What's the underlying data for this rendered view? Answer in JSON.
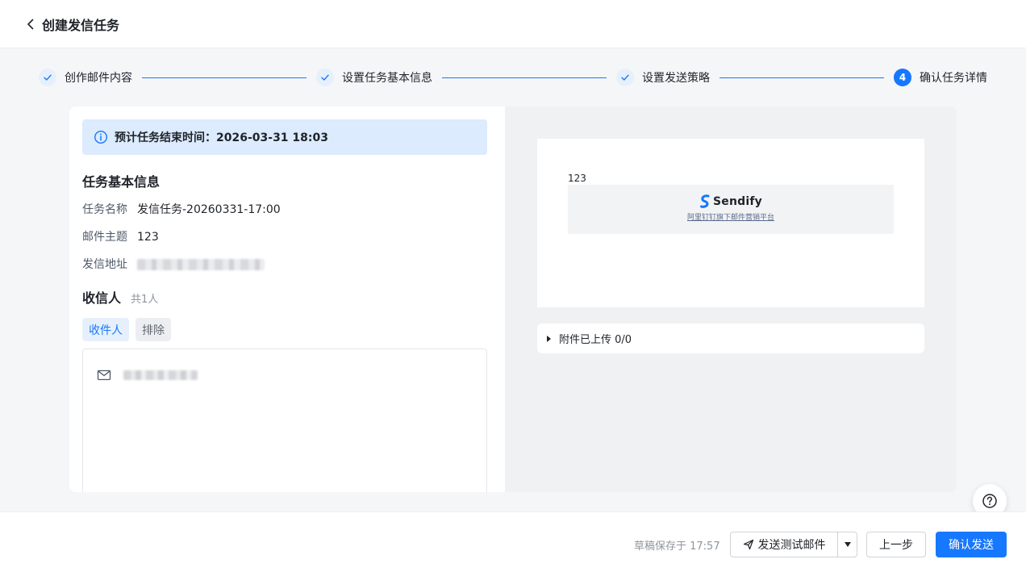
{
  "header": {
    "title": "创建发信任务",
    "back_icon": "chevron-left-icon"
  },
  "steps": [
    {
      "label": "创作邮件内容",
      "state": "done",
      "icon": "check-icon"
    },
    {
      "label": "设置任务基本信息",
      "state": "done",
      "icon": "check-icon"
    },
    {
      "label": "设置发送策略",
      "state": "done",
      "icon": "check-icon"
    },
    {
      "label": "确认任务详情",
      "state": "active",
      "number": "4"
    }
  ],
  "banner": {
    "text": "预计任务结束时间：2026-03-31 18:03",
    "icon": "info-circle-icon"
  },
  "basic_info": {
    "title": "任务基本信息",
    "task_name_label": "任务名称",
    "task_name_value": "发信任务-20260331-17:00",
    "subject_label": "邮件主题",
    "subject_value": "123",
    "sender_label": "发信地址"
  },
  "recipients": {
    "title": "收信人",
    "count": "共1人",
    "tab_include": "收件人",
    "tab_exclude": "排除",
    "item_icon": "mail-icon"
  },
  "preview": {
    "body_text": "123",
    "brand_name": "Sendify",
    "brand_sub": "阿里钉钉旗下邮件营销平台"
  },
  "attachment": {
    "label": "附件已上传 0/0"
  },
  "footer": {
    "draft_status": "草稿保存于 17:57",
    "send_test_label": "发送测试邮件",
    "prev_label": "上一步",
    "confirm_label": "确认发送"
  },
  "colors": {
    "primary": "#1677ff",
    "banner_bg": "#dcebfd"
  }
}
